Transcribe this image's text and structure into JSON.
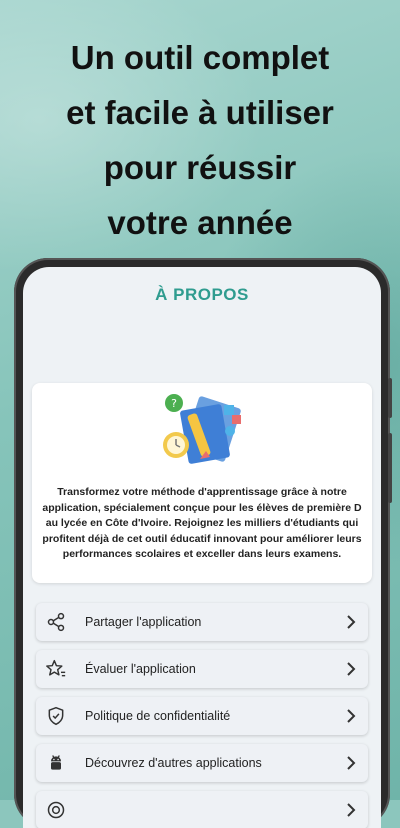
{
  "headline": {
    "line1": "Un outil complet",
    "line2": "et facile à utiliser",
    "line3": "pour réussir",
    "line4": "votre année"
  },
  "screen": {
    "title": "À PROPOS",
    "about_text": "Transformez votre méthode d'apprentissage grâce à notre application, spécialement conçue pour les élèves de première D au lycée en Côte d'Ivoire. Rejoignez les milliers d'étudiants qui profitent déjà de cet outil éducatif innovant pour améliorer leurs performances scolaires et exceller dans leurs examens."
  },
  "menu": [
    {
      "label": "Partager l'application",
      "icon": "share-icon"
    },
    {
      "label": "Évaluer l'application",
      "icon": "star-rate-icon"
    },
    {
      "label": "Politique de confidentialité",
      "icon": "shield-check-icon"
    },
    {
      "label": "Découvrez d'autres applications",
      "icon": "android-icon"
    },
    {
      "label": "",
      "icon": "globe-icon"
    }
  ],
  "colors": {
    "accent": "#2f9c8f",
    "background": "#8cc6bd"
  }
}
